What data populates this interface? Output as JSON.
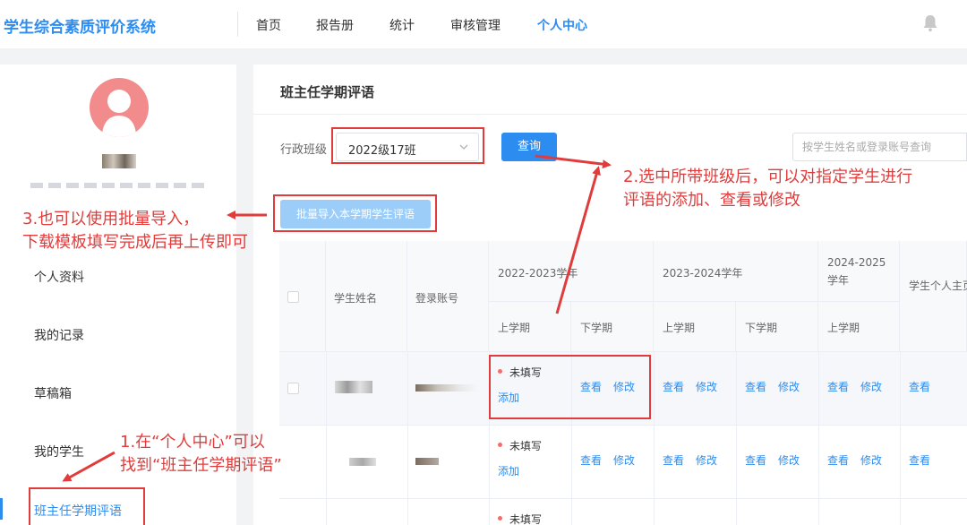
{
  "app": {
    "title": "学生综合素质评价系统"
  },
  "nav": {
    "items": [
      {
        "label": "首页",
        "active": false
      },
      {
        "label": "报告册",
        "active": false
      },
      {
        "label": "统计",
        "active": false
      },
      {
        "label": "审核管理",
        "active": false
      },
      {
        "label": "个人中心",
        "active": true
      }
    ],
    "bell_icon": "bell-icon"
  },
  "sidebar": {
    "menu": [
      {
        "label": "个人资料",
        "active": false
      },
      {
        "label": "我的记录",
        "active": false
      },
      {
        "label": "草稿箱",
        "active": false
      },
      {
        "label": "我的学生",
        "active": false
      },
      {
        "label": "班主任学期评语",
        "active": true
      }
    ]
  },
  "main": {
    "title": "班主任学期评语",
    "filter_label": "行政班级",
    "class_value": "2022级17班",
    "query_label": "查询",
    "search_placeholder": "按学生姓名或登录账号查询",
    "import_label": "批量导入本学期学生评语"
  },
  "table": {
    "headers": {
      "name": "学生姓名",
      "account": "登录账号",
      "year1": "2022-2023学年",
      "year2": "2023-2024学年",
      "year3": "2024-2025学年",
      "homepage": "学生个人主页",
      "sem1": "上学期",
      "sem2": "下学期",
      "sem3": "上学期",
      "sem4": "下学期",
      "sem5": "上学期"
    },
    "status_unfilled": "未填写",
    "add_label": "添加",
    "view_label": "查看",
    "edit_label": "修改"
  },
  "annotations": {
    "note1_line1": "1.在“个人中心”可以",
    "note1_line2": "找到“班主任学期评语”",
    "note2_line1": "2.选中所带班级后，可以对指定学生进行",
    "note2_line2": "评语的添加、查看或修改",
    "note3_line1": "3.也可以使用批量导入，",
    "note3_line2": "下载模板填写完成后再上传即可",
    "color": "#e03c3c"
  },
  "colors": {
    "accent": "#2d8cf0",
    "status_dot": "#f56c6c"
  }
}
